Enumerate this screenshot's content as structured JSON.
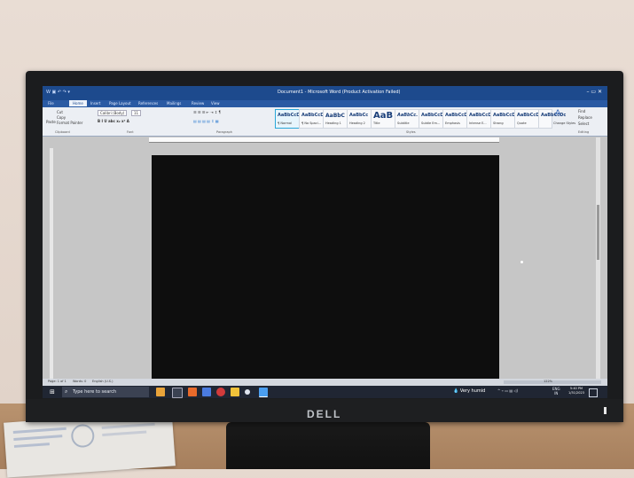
{
  "window": {
    "title": "Document1 - Microsoft Word (Product Activation Failed)"
  },
  "ribbon": {
    "tabs": [
      {
        "label": "File"
      },
      {
        "label": "Home"
      },
      {
        "label": "Insert"
      },
      {
        "label": "Page Layout"
      },
      {
        "label": "References"
      },
      {
        "label": "Mailings"
      },
      {
        "label": "Review"
      },
      {
        "label": "View"
      }
    ],
    "clipboard": {
      "paste": "Paste",
      "cut": "Cut",
      "copy": "Copy",
      "format_painter": "Format Painter",
      "group": "Clipboard"
    },
    "font": {
      "name": "Calibri (Body)",
      "size": "11",
      "group": "Font"
    },
    "paragraph": {
      "group": "Paragraph"
    },
    "styles": {
      "group": "Styles",
      "items": [
        {
          "sample": "AaBbCcDc",
          "name": "¶ Normal"
        },
        {
          "sample": "AaBbCcDc",
          "name": "¶ No Spaci..."
        },
        {
          "sample": "AaBbC",
          "name": "Heading 1"
        },
        {
          "sample": "AaBbCc",
          "name": "Heading 2"
        },
        {
          "sample": "AaB",
          "name": "Title"
        },
        {
          "sample": "AaBbCc.",
          "name": "Subtitle"
        },
        {
          "sample": "AaBbCcDc",
          "name": "Subtle Em..."
        },
        {
          "sample": "AaBbCcDc",
          "name": "Emphasis"
        },
        {
          "sample": "AaBbCcDc",
          "name": "Intense E..."
        },
        {
          "sample": "AaBbCcDc",
          "name": "Strong"
        },
        {
          "sample": "AaBbCcDc",
          "name": "Quote"
        },
        {
          "sample": "AaBbCcDc",
          "name": ""
        }
      ],
      "change_styles": "Change Styles"
    },
    "editing": {
      "find": "Find",
      "replace": "Replace",
      "select": "Select",
      "group": "Editing"
    }
  },
  "statusbar": {
    "page": "Page: 1 of 1",
    "words": "Words: 0",
    "language": "English (U.S.)",
    "zoom": "122%"
  },
  "taskbar": {
    "search_placeholder": "Type here to search",
    "weather": "Very humid",
    "lang": "ENG",
    "lang_sub": "IN",
    "time": "5:40 PM",
    "date": "1/31/2023"
  },
  "monitor": {
    "brand": "DELL"
  }
}
